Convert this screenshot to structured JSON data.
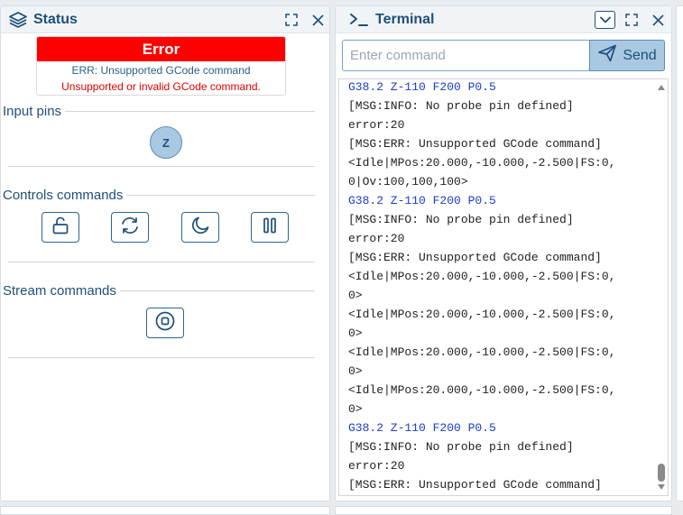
{
  "status_panel": {
    "title": "Status",
    "icon": "layers-icon",
    "error": {
      "title": "Error",
      "line1": "ERR: Unsupported GCode command",
      "line2": "Unsupported or invalid GCode command."
    },
    "input_pins": {
      "title": "Input pins",
      "pins": [
        "Z"
      ]
    },
    "controls": {
      "title": "Controls commands",
      "buttons": [
        "unlock-icon",
        "reset-icon",
        "sleep-icon",
        "pause-icon"
      ]
    },
    "stream": {
      "title": "Stream commands",
      "buttons": [
        "stop-icon"
      ]
    }
  },
  "terminal_panel": {
    "title": "Terminal",
    "input": {
      "placeholder": "Enter command",
      "value": ""
    },
    "send_label": "Send",
    "lines": [
      {
        "text": "G38.2 Z-110 F200 P0.5",
        "kind": "cmd"
      },
      {
        "text": "[MSG:INFO: No probe pin defined]",
        "kind": "out"
      },
      {
        "text": "error:20",
        "kind": "out"
      },
      {
        "text": "[MSG:ERR: Unsupported GCode command]",
        "kind": "out"
      },
      {
        "text": "<Idle|MPos:20.000,-10.000,-2.500|FS:0,",
        "kind": "out"
      },
      {
        "text": "0|Ov:100,100,100>",
        "kind": "out"
      },
      {
        "text": "G38.2 Z-110 F200 P0.5",
        "kind": "cmd"
      },
      {
        "text": "[MSG:INFO: No probe pin defined]",
        "kind": "out"
      },
      {
        "text": "error:20",
        "kind": "out"
      },
      {
        "text": "[MSG:ERR: Unsupported GCode command]",
        "kind": "out"
      },
      {
        "text": "<Idle|MPos:20.000,-10.000,-2.500|FS:0,",
        "kind": "out"
      },
      {
        "text": "0>",
        "kind": "out"
      },
      {
        "text": "<Idle|MPos:20.000,-10.000,-2.500|FS:0,",
        "kind": "out"
      },
      {
        "text": "0>",
        "kind": "out"
      },
      {
        "text": "<Idle|MPos:20.000,-10.000,-2.500|FS:0,",
        "kind": "out"
      },
      {
        "text": "0>",
        "kind": "out"
      },
      {
        "text": "<Idle|MPos:20.000,-10.000,-2.500|FS:0,",
        "kind": "out"
      },
      {
        "text": "0>",
        "kind": "out"
      },
      {
        "text": "G38.2 Z-110 F200 P0.5",
        "kind": "cmd"
      },
      {
        "text": "[MSG:INFO: No probe pin defined]",
        "kind": "out"
      },
      {
        "text": "error:20",
        "kind": "out"
      },
      {
        "text": "[MSG:ERR: Unsupported GCode command]",
        "kind": "out"
      }
    ]
  },
  "colors": {
    "accent": "#1f4f79",
    "error": "#ff0000",
    "command_echo": "#1a3dcc"
  }
}
